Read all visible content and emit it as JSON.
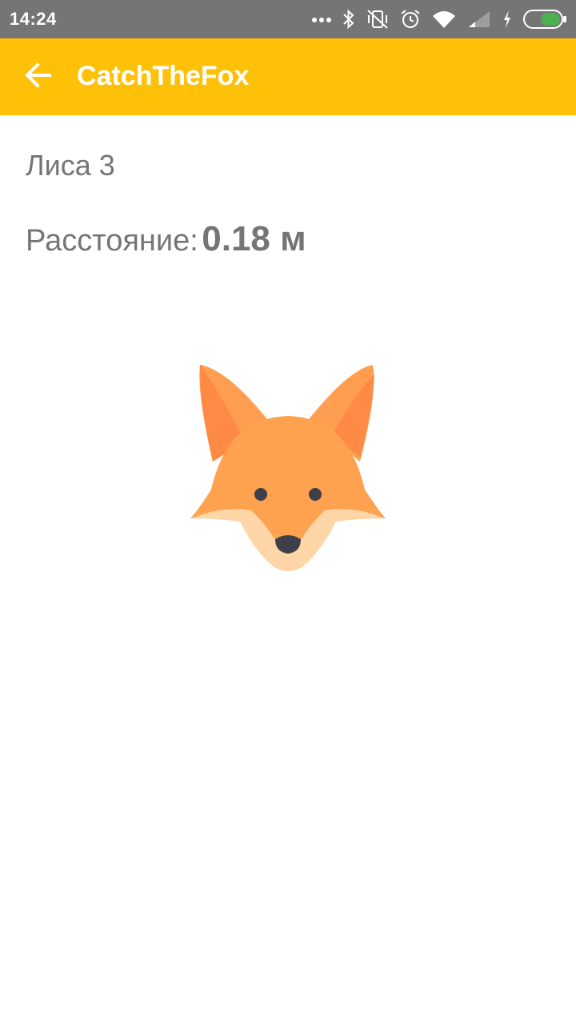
{
  "status_bar": {
    "time": "14:24",
    "icons": [
      "more-dots-icon",
      "bluetooth-icon",
      "vibrate-off-icon",
      "alarm-icon",
      "wifi-icon",
      "cell-signal-icon",
      "charging-icon",
      "battery-icon"
    ],
    "background": "#757575"
  },
  "app_bar": {
    "title": "CatchTheFox",
    "back_icon": "arrow-back-icon",
    "background": "#FFC107"
  },
  "main": {
    "fox_name": "Лиса 3",
    "distance_label": "Расстояние:",
    "distance_value": "0.18 м",
    "text_color": "#757575",
    "image": "fox-head-icon"
  }
}
